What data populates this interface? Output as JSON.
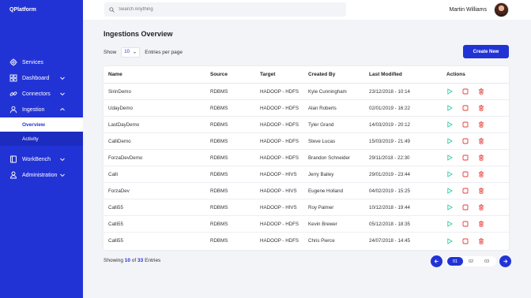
{
  "app": {
    "brand": "QPlatform"
  },
  "sidebar": {
    "items": [
      {
        "label": "Services",
        "icon": "gear-icon",
        "chevron": false
      },
      {
        "label": "Dashboard",
        "icon": "grid-icon",
        "chevron": true
      },
      {
        "label": "Connectors",
        "icon": "link-icon",
        "chevron": true
      },
      {
        "label": "Ingestion",
        "icon": "user-icon",
        "chevron": true,
        "expanded": true
      }
    ],
    "sub_items": [
      {
        "label": "Overview",
        "active": true
      },
      {
        "label": "Activity",
        "active": false
      }
    ],
    "items_bottom": [
      {
        "label": "WorkBench",
        "icon": "book-icon",
        "chevron": true
      },
      {
        "label": "Administration",
        "icon": "person-icon",
        "chevron": true
      }
    ]
  },
  "search": {
    "placeholder": "Search Anything"
  },
  "user": {
    "name": "Martin Williams"
  },
  "main": {
    "title": "Ingestions Overview",
    "show_label": "Show",
    "page_size": "10",
    "entries_per_page": "Entries per page",
    "create_label": "Create New"
  },
  "table": {
    "headers": {
      "name": "Name",
      "source": "Source",
      "target": "Target",
      "created_by": "Created By",
      "last_modified": "Last Modified",
      "actions": "Actions"
    },
    "rows": [
      {
        "name": "SirinDemo",
        "source": "RDBMS",
        "target": "HADOOP - HDFS",
        "created_by": "Kyle Cunningham",
        "last_modified": "23/12/2018 - 10:14"
      },
      {
        "name": "UdayDemo",
        "source": "RDBMS",
        "target": "HADOOP - HDFS",
        "created_by": "Alan Roberts",
        "last_modified": "02/01/2019 - 16:22"
      },
      {
        "name": "LastDayDemo",
        "source": "RDBMS",
        "target": "HADOOP - HDFS",
        "created_by": "Tyler Grand",
        "last_modified": "14/03/2019 - 20:12"
      },
      {
        "name": "CalliDemo",
        "source": "RDBMS",
        "target": "HADOOP - HDFS",
        "created_by": "Steve Lucas",
        "last_modified": "15/03/2019 - 21:49"
      },
      {
        "name": "ForzaDevDemo",
        "source": "RDBMS",
        "target": "HADOOP - HDFS",
        "created_by": "Brandon Schneider",
        "last_modified": "29/11/2018 - 22:30"
      },
      {
        "name": "Calli",
        "source": "RDBMS",
        "target": "HADOOP - HIVS",
        "created_by": "Jerry Bailey",
        "last_modified": "29/01/2019 - 23:44"
      },
      {
        "name": "ForzaDev",
        "source": "RDBMS",
        "target": "HADOOP - HIVS",
        "created_by": "Eugene Holland",
        "last_modified": "04/02/2019 - 15:25"
      },
      {
        "name": "Calli55",
        "source": "RDBMS",
        "target": "HADOOP - HIVS",
        "created_by": "Roy Palmer",
        "last_modified": "10/12/2018 - 19:44"
      },
      {
        "name": "Calli55",
        "source": "RDBMS",
        "target": "HADOOP - HDFS",
        "created_by": "Kevin Brewer",
        "last_modified": "05/12/2018 - 18:35"
      },
      {
        "name": "Calli55",
        "source": "RDBMS",
        "target": "HADOOP - HDFS",
        "created_by": "Chris Pierce",
        "last_modified": "24/07/2018 - 14:45"
      }
    ]
  },
  "footer": {
    "showing": "Showing",
    "shown": "10",
    "of": "of",
    "total": "33",
    "entries": "Entries"
  },
  "pagination": {
    "pages": [
      "01",
      "02",
      "03"
    ],
    "current": "01"
  },
  "colors": {
    "accent": "#2233d6",
    "play": "#2ecc9a",
    "stop": "#e53935",
    "delete": "#e53935"
  }
}
